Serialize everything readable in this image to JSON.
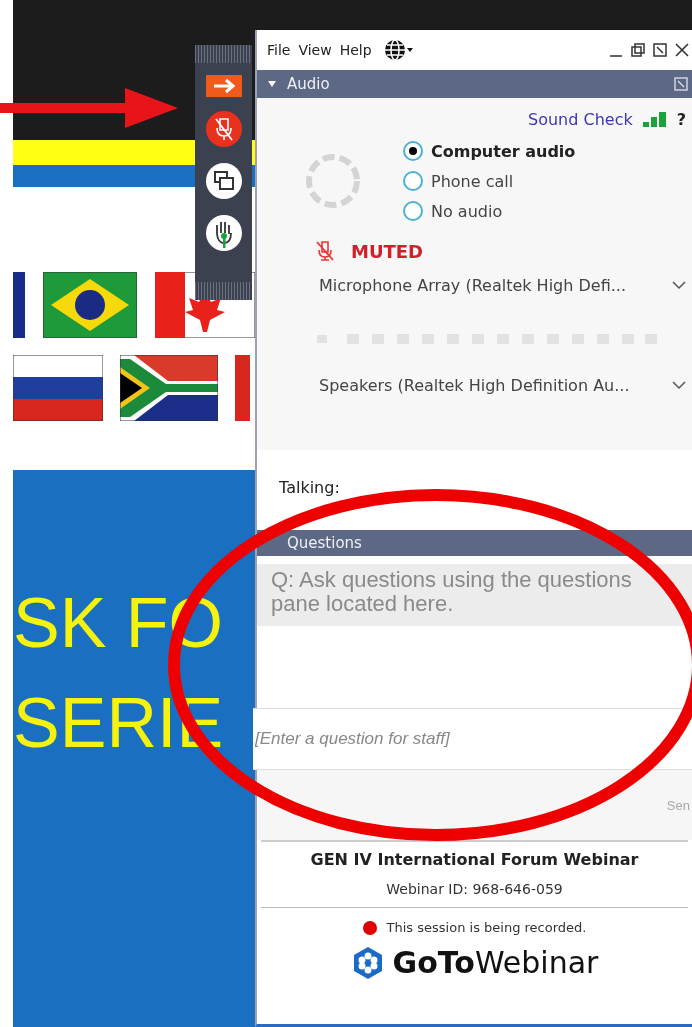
{
  "slide": {
    "lines": [
      "SK FO",
      "SERIE"
    ]
  },
  "menu": [
    "File",
    "View",
    "Help"
  ],
  "audio": {
    "title": "Audio",
    "expanded": true,
    "sound_check": "Sound Check",
    "help": "?",
    "muted": true,
    "muted_label": "MUTED",
    "options": [
      {
        "label": "Computer audio",
        "selected": true
      },
      {
        "label": "Phone call",
        "selected": false
      },
      {
        "label": "No audio",
        "selected": false
      }
    ],
    "microphone": "Microphone Array (Realtek High Defi...",
    "speakers": "Speakers (Realtek High Definition Au...",
    "talking": "Talking:"
  },
  "questions": {
    "title": "Questions",
    "messages": [
      "Q: Ask questions using the questions pane located here."
    ],
    "placeholder": "[Enter a question for staff]",
    "send": "Sen"
  },
  "footer": {
    "title": "GEN IV International Forum Webinar",
    "webinar_id": "Webinar ID: 968-646-059",
    "recording": true,
    "recording_text": "This session is being recorded.",
    "logo": "**GoTo**Webinar"
  }
}
